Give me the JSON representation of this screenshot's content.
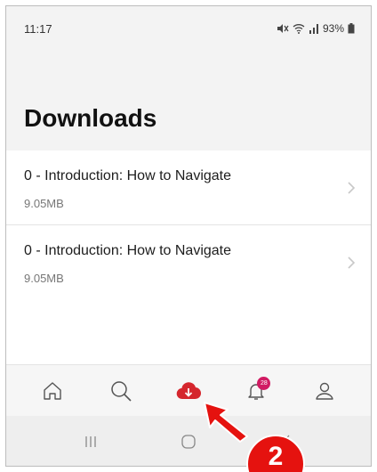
{
  "status_bar": {
    "time": "11:17",
    "battery": "93%",
    "icons": [
      "mute-icon",
      "wifi-icon",
      "signal-icon",
      "battery-icon"
    ]
  },
  "page": {
    "title": "Downloads"
  },
  "downloads": [
    {
      "title": "0 - Introduction: How to Navigate",
      "size": "9.05MB"
    },
    {
      "title": "0 - Introduction: How to Navigate",
      "size": "9.05MB"
    }
  ],
  "bottom_nav": {
    "items": [
      "home-icon",
      "search-icon",
      "download-icon",
      "notification-icon",
      "profile-icon"
    ],
    "active": "download-icon",
    "notification_badge": "28"
  },
  "system_nav": {
    "buttons": [
      "recent-apps-icon",
      "home-button-icon",
      "back-icon"
    ]
  },
  "annotation": {
    "step_number": "2"
  },
  "colors": {
    "accent": "#d5262d",
    "badge": "#d11b63",
    "annotation": "#e5120f"
  }
}
